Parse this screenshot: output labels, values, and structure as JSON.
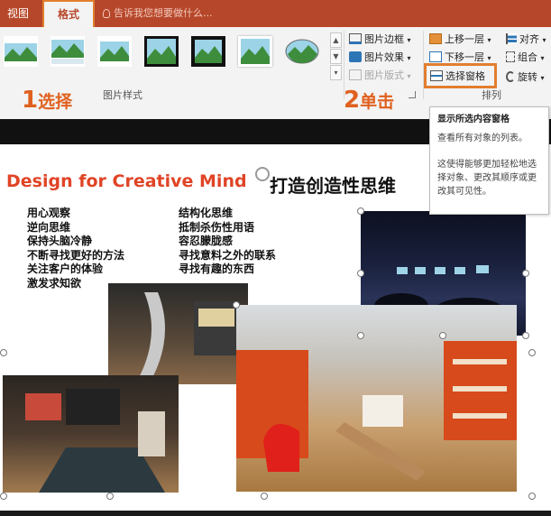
{
  "ribbon": {
    "tabs": {
      "view": "视图",
      "format": "格式"
    },
    "tell_me": "告诉我您想要做什么...",
    "picture_styles": {
      "label": "图片样式",
      "commands": {
        "border": "图片边框",
        "effects": "图片效果",
        "layout": "图片版式"
      }
    },
    "arrange": {
      "label": "排列",
      "commands": {
        "bring_forward": "上移一层",
        "send_backward": "下移一层",
        "selection_pane": "选择窗格",
        "align": "对齐",
        "group": "组合",
        "rotate": "旋转"
      }
    }
  },
  "callouts": {
    "step1": {
      "num": "1",
      "text": "选择"
    },
    "step2": {
      "num": "2",
      "text": "单击"
    }
  },
  "tooltip": {
    "title": "显示所选内容窗格",
    "line1": "查看所有对象的列表。",
    "line2": "这使得能够更加轻松地选择对象、更改其顺序或更改其可见性。"
  },
  "slide": {
    "title_en": "Design for Creative Mind",
    "title_cn": "打造创造性思维",
    "left_list": [
      "用心观察",
      "逆向思维",
      "保持头脑冷静",
      "不断寻找更好的方法",
      "关注客户的体验",
      "激发求知欲"
    ],
    "right_list": [
      "结构化思维",
      "抵制杀伤性用语",
      "容忍朦胧感",
      "寻找意料之外的联系",
      "寻找有趣的东西"
    ]
  },
  "colors": {
    "accent": "#b7472a",
    "callout": "#e0611f",
    "title": "#e04426"
  }
}
